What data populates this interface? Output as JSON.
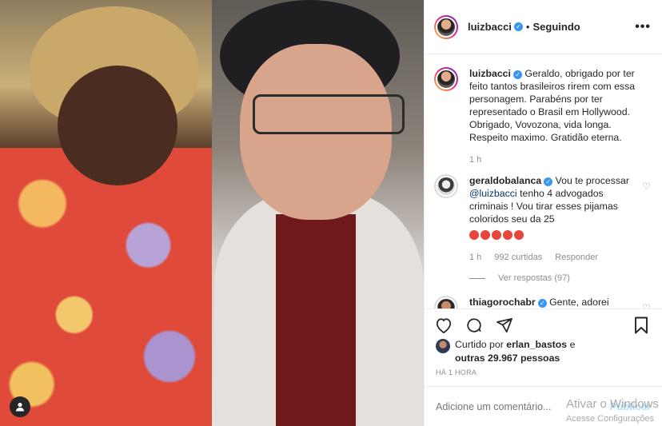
{
  "header": {
    "username": "luizbacci",
    "separator": "•",
    "follow_status": "Seguindo",
    "more": "•••"
  },
  "caption": {
    "username": "luizbacci",
    "text": "Geraldo, obrigado por ter feito tantos brasileiros rirem com essa personagem. Parabéns por ter representado o Brasil em Hollywood. Obrigado, Vovozona, vida longa. Respeito maximo. Gratidão eterna.",
    "time": "1 h"
  },
  "comments": [
    {
      "username": "geraldobalanca",
      "text_before": "Vou te processar",
      "mention": "@luizbacci",
      "text_after": "tenho 4 advogados criminais ! Vou tirar esses pijamas coloridos seu da 25",
      "emoji": [
        "angry-face",
        "angry-face",
        "angry-face",
        "angry-face",
        "angry-face"
      ],
      "time": "1 h",
      "likes": "992 curtidas",
      "reply": "Responder",
      "view_replies": "Ver respostas (97)"
    },
    {
      "username": "thiagorochabr",
      "text": "Gente, adorei"
    }
  ],
  "likes": {
    "prefix": "Curtido por",
    "user": "erlan_bastos",
    "middle": "e",
    "others": "outras 29.967 pessoas"
  },
  "timestamp": "HÁ 1 HORA",
  "add_comment": {
    "placeholder": "Adicione um comentário...",
    "post": "Publicar"
  },
  "watermark": {
    "line1": "Ativar o Windows",
    "line2": "Acesse Configurações"
  }
}
